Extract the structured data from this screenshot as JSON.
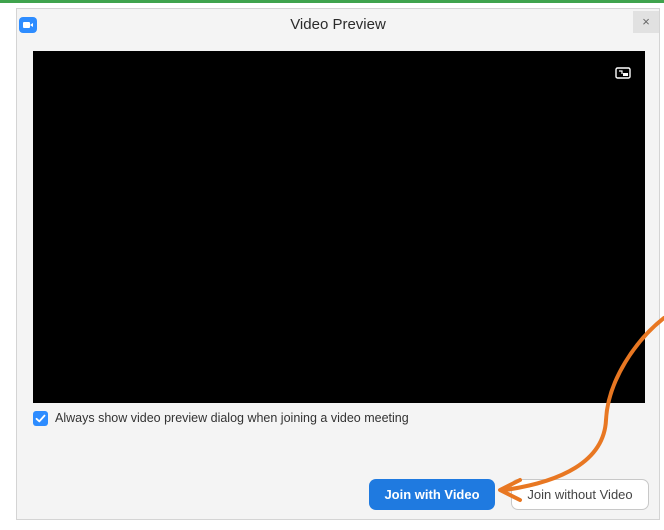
{
  "dialog": {
    "title": "Video Preview",
    "close_label": "×",
    "app_icon": "zoom-camera-icon"
  },
  "video": {
    "overlay_icon": "picture-in-picture-icon"
  },
  "preferences": {
    "always_show_checked": true,
    "always_show_label": "Always show video preview dialog when joining a video meeting"
  },
  "buttons": {
    "join_with_video": "Join with Video",
    "join_without_video": "Join without Video"
  },
  "annotation": {
    "arrow_color": "#e87722"
  },
  "colors": {
    "accent": "#1f7ae0",
    "video_bg": "#000000"
  }
}
